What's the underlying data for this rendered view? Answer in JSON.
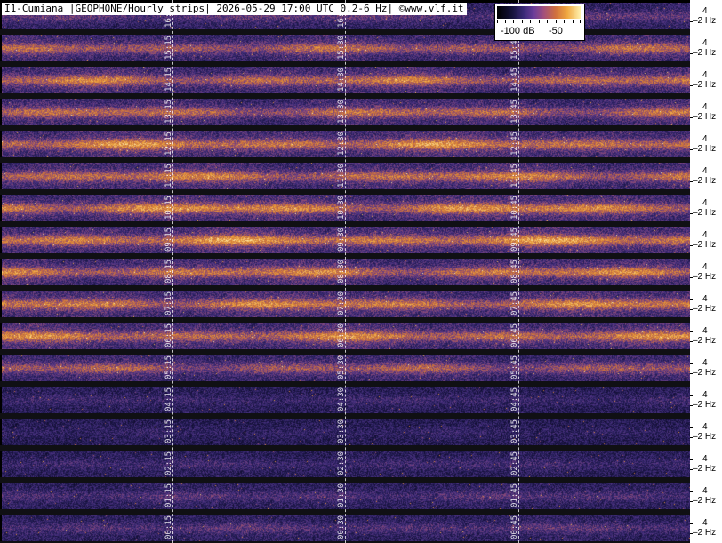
{
  "header": {
    "title": "I1-Cumiana |GEOPHONE/Hourly strips| 2026-05-29 17:00 UTC 0.2-6 Hz| ©www.vlf.it"
  },
  "colorbar": {
    "low_label": "-100 dB",
    "high_label": "-50"
  },
  "frequency_axis": {
    "upper_label": "4",
    "lower_label": "2 Hz"
  },
  "strips": [
    {
      "labels": [
        "16:15",
        "16:30",
        "16:45"
      ],
      "activity": 0.35
    },
    {
      "labels": [
        "15:15",
        "15:30",
        "15:45"
      ],
      "activity": 0.62
    },
    {
      "labels": [
        "14:15",
        "14:30",
        "14:45"
      ],
      "activity": 0.7
    },
    {
      "labels": [
        "13:15",
        "13:30",
        "13:45"
      ],
      "activity": 0.66
    },
    {
      "labels": [
        "12:15",
        "12:30",
        "12:45"
      ],
      "activity": 0.78
    },
    {
      "labels": [
        "11:15",
        "11:30",
        "11:45"
      ],
      "activity": 0.72
    },
    {
      "labels": [
        "10:15",
        "10:30",
        "10:45"
      ],
      "activity": 0.8
    },
    {
      "labels": [
        "09:15",
        "09:30",
        "09:45"
      ],
      "activity": 0.82
    },
    {
      "labels": [
        "08:15",
        "08:30",
        "08:45"
      ],
      "activity": 0.74
    },
    {
      "labels": [
        "07:15",
        "07:30",
        "07:45"
      ],
      "activity": 0.76
    },
    {
      "labels": [
        "06:15",
        "06:30",
        "06:45"
      ],
      "activity": 0.74
    },
    {
      "labels": [
        "05:15",
        "05:30",
        "05:45"
      ],
      "activity": 0.58
    },
    {
      "labels": [
        "04:15",
        "04:30",
        "04:45"
      ],
      "activity": 0.18
    },
    {
      "labels": [
        "03:15",
        "03:30",
        "03:45"
      ],
      "activity": 0.12
    },
    {
      "labels": [
        "02:15",
        "02:30",
        "02:45"
      ],
      "activity": 0.2
    },
    {
      "labels": [
        "01:15",
        "01:30",
        "01:45"
      ],
      "activity": 0.28
    },
    {
      "labels": [
        "00:15",
        "00:30",
        "00:45"
      ],
      "activity": 0.3
    }
  ]
}
